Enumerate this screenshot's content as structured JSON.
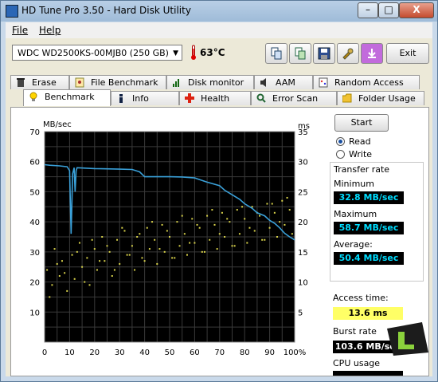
{
  "window": {
    "title": "HD Tune Pro 3.50 - Hard Disk Utility",
    "min": "–",
    "max": "□",
    "close": "X"
  },
  "menu": {
    "file": "File",
    "help": "Help"
  },
  "toolbar": {
    "drive": "WDC WD2500KS-00MJB0 (250 GB)",
    "temperature": "63°C",
    "exit": "Exit",
    "buttons": [
      "copy-icon",
      "copy-screenshot-icon",
      "save-icon",
      "options-icon",
      "download-icon"
    ]
  },
  "tabs_top": [
    "Erase",
    "File Benchmark",
    "Disk monitor",
    "AAM",
    "Random Access"
  ],
  "tabs_bottom": [
    "Benchmark",
    "Info",
    "Health",
    "Error Scan",
    "Folder Usage"
  ],
  "benchmark": {
    "start": "Start",
    "read": "Read",
    "write": "Write",
    "transfer_rate_label": "Transfer rate",
    "minimum_label": "Minimum",
    "minimum": "32.8 MB/sec",
    "maximum_label": "Maximum",
    "maximum": "58.7 MB/sec",
    "average_label": "Average:",
    "average": "50.4 MB/sec",
    "access_time_label": "Access time:",
    "access_time": "13.6 ms",
    "burst_rate_label": "Burst rate",
    "burst_rate": "103.6 MB/sec",
    "cpu_label": "CPU usage"
  },
  "chart_data": {
    "type": "line",
    "left_axis_label": "MB/sec",
    "right_axis_label": "ms",
    "y_left_range": [
      0,
      70
    ],
    "y_right_range": [
      0,
      35
    ],
    "x_range": [
      0,
      100
    ],
    "left_ticks": [
      "70",
      "60",
      "50",
      "40",
      "30",
      "20",
      "10"
    ],
    "right_ticks": [
      "35",
      "30",
      "25",
      "20",
      "15",
      "10",
      "5"
    ],
    "x_ticks": [
      "0",
      "10",
      "20",
      "30",
      "40",
      "50",
      "60",
      "70",
      "80",
      "90",
      "100%"
    ],
    "grid": true,
    "series": [
      {
        "type": "line",
        "color": "#3aa0d8",
        "x": [
          0,
          2,
          6,
          9,
          10,
          10.6,
          11.2,
          11.8,
          12.2,
          12.6,
          13,
          20,
          30,
          35,
          38,
          40,
          46,
          50,
          55,
          60,
          62,
          65,
          70,
          72,
          75,
          78,
          80,
          83,
          85,
          88,
          90,
          92,
          94,
          96,
          98,
          100
        ],
        "y": [
          59,
          58.8,
          58.6,
          58.3,
          57,
          36,
          56,
          58,
          50,
          57,
          58,
          57.7,
          57.5,
          57.4,
          56.6,
          55,
          55,
          55,
          54.9,
          54.6,
          54,
          53.2,
          52,
          50.5,
          49,
          47.5,
          46,
          44.5,
          43,
          42,
          40.5,
          39.5,
          38,
          36.2,
          35,
          34
        ]
      },
      {
        "type": "scatter",
        "color": "#d8d24a",
        "x": [
          1,
          3,
          4,
          6,
          7,
          9,
          11,
          12,
          14,
          15,
          17,
          18,
          20,
          21,
          23,
          24,
          26,
          27,
          29,
          30,
          32,
          33,
          35,
          36,
          38,
          39,
          41,
          42,
          44,
          45,
          47,
          48,
          50,
          51,
          53,
          54,
          56,
          57,
          59,
          60,
          62,
          63,
          65,
          66,
          68,
          69,
          71,
          72,
          74,
          75,
          77,
          78,
          80,
          81,
          83,
          84,
          86,
          87,
          89,
          90,
          92,
          93,
          95,
          96,
          98,
          99,
          2,
          5,
          8,
          13,
          16,
          19,
          22,
          25,
          28,
          31,
          34,
          37,
          40,
          43,
          46,
          49,
          52,
          55,
          58,
          61,
          64,
          67,
          70,
          73,
          76,
          79,
          82,
          85,
          88,
          91,
          94,
          97
        ],
        "y": [
          24,
          19,
          31,
          22,
          27,
          17,
          29,
          21,
          33,
          25,
          28,
          19,
          31,
          24,
          35,
          27,
          30,
          22,
          34,
          26,
          37,
          29,
          32,
          24,
          36,
          28,
          38,
          31,
          34,
          26,
          39,
          30,
          35,
          28,
          40,
          32,
          36,
          29,
          41,
          33,
          38,
          30,
          42,
          34,
          39,
          31,
          43,
          35,
          40,
          32,
          44,
          36,
          41,
          33,
          45,
          37,
          42,
          34,
          46,
          38,
          43,
          35,
          47,
          39,
          44,
          36,
          15,
          26,
          23,
          30,
          20,
          34,
          27,
          32,
          24,
          38,
          29,
          35,
          27,
          40,
          31,
          37,
          28,
          42,
          33,
          39,
          30,
          44,
          36,
          41,
          32,
          45,
          38,
          43,
          34,
          46,
          40,
          48
        ]
      }
    ]
  }
}
